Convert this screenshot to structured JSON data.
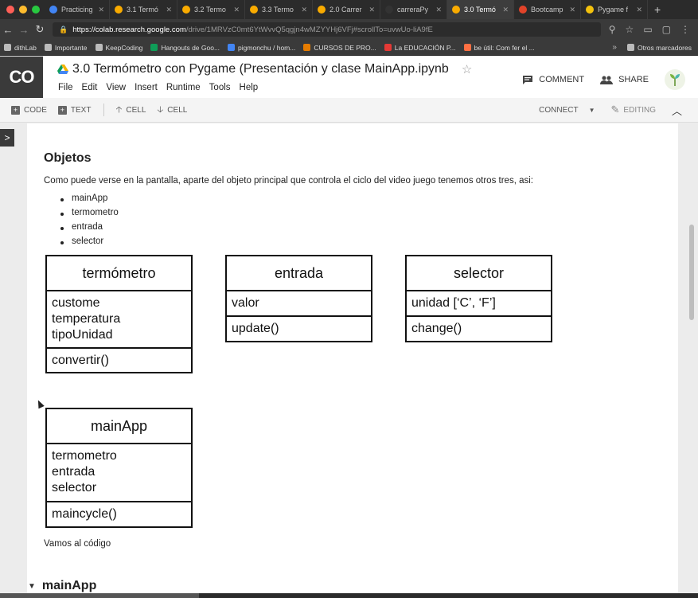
{
  "browser": {
    "tabs": [
      {
        "label": "Practicing",
        "color": "#4285f4",
        "active": false
      },
      {
        "label": "3.1 Termó",
        "color": "#f9ab00",
        "active": false
      },
      {
        "label": "3.2 Termo",
        "color": "#f9ab00",
        "active": false
      },
      {
        "label": "3.3 Termo",
        "color": "#f9ab00",
        "active": false
      },
      {
        "label": "2.0 Carrer",
        "color": "#f9ab00",
        "active": false
      },
      {
        "label": "carreraPy",
        "color": "#333333",
        "active": false
      },
      {
        "label": "3.0 Termó",
        "color": "#f9ab00",
        "active": true
      },
      {
        "label": "Bootcamp",
        "color": "#e24329",
        "active": false
      },
      {
        "label": "Pygame f",
        "color": "#f4c20d",
        "active": false
      }
    ],
    "new_tab": "+",
    "url_host": "https://colab.research.google.com",
    "url_path": "/drive/1MRVzC0mt6YtWvvQ5qgjn4wMZYYHj6VFj#scrollTo=uvwUo-liA9fE",
    "bookmarks": [
      {
        "label": "dithLab",
        "color": "#bbbbbb"
      },
      {
        "label": "Importante",
        "color": "#bbbbbb"
      },
      {
        "label": "KeepCoding",
        "color": "#bbbbbb"
      },
      {
        "label": "Hangouts de Goo...",
        "color": "#0f9d58"
      },
      {
        "label": "pigmonchu / hom...",
        "color": "#4285f4"
      },
      {
        "label": "CURSOS DE PRO...",
        "color": "#e67c00"
      },
      {
        "label": "La EDUCACIÓN P...",
        "color": "#e53935"
      },
      {
        "label": "be útil: Com fer el ...",
        "color": "#ff7043"
      }
    ],
    "bookmarks_more": "»",
    "other_bookmarks": "Otros marcadores"
  },
  "colab": {
    "logo": "CO",
    "title": "3.0 Termómetro con Pygame (Presentación y clase MainApp.ipynb",
    "menu": [
      "File",
      "Edit",
      "View",
      "Insert",
      "Runtime",
      "Tools",
      "Help"
    ],
    "comment_label": "COMMENT",
    "share_label": "SHARE",
    "toolbar": {
      "code": "CODE",
      "text": "TEXT",
      "cell_up": "CELL",
      "cell_down": "CELL",
      "connect": "CONNECT",
      "editing": "EDITING"
    }
  },
  "content": {
    "heading": "Objetos",
    "intro": "Como puede verse en la pantalla, aparte del objeto principal que controla el ciclo del video juego tenemos otros tres, asi:",
    "bullets": [
      "mainApp",
      "termometro",
      "entrada",
      "selector"
    ],
    "classes": {
      "termometro": {
        "name": "termómetro",
        "attrs": [
          "custome",
          "temperatura",
          "tipoUnidad"
        ],
        "methods": [
          "convertir()"
        ]
      },
      "entrada": {
        "name": "entrada",
        "attrs": [
          "valor"
        ],
        "methods": [
          "update()"
        ]
      },
      "selector": {
        "name": "selector",
        "attrs": [
          "unidad [‘C’, ‘F’]"
        ],
        "methods": [
          "change()"
        ]
      },
      "mainapp": {
        "name": "mainApp",
        "attrs": [
          "termometro",
          "entrada",
          "selector"
        ],
        "methods": [
          "maincycle()"
        ]
      }
    },
    "footer_text": "Vamos al código",
    "next_section": "mainApp"
  }
}
